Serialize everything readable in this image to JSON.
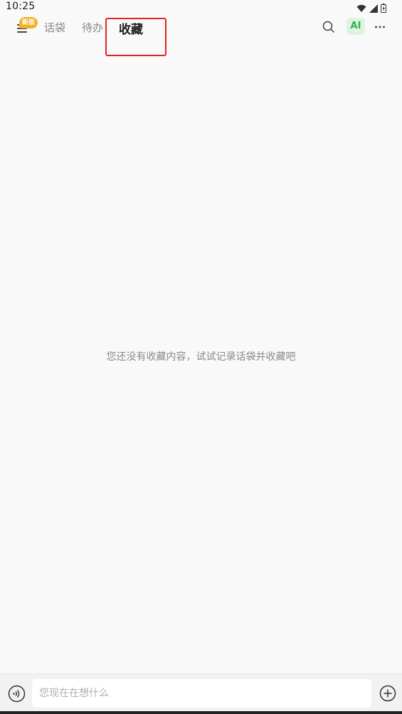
{
  "status_bar": {
    "time": "10:25"
  },
  "nav": {
    "new_badge": "新版",
    "tabs": [
      {
        "label": "话袋",
        "active": false
      },
      {
        "label": "待办",
        "active": false
      },
      {
        "label": "收藏",
        "active": true
      }
    ],
    "ai_label": "AI"
  },
  "main": {
    "empty_message": "您还没有收藏内容，试试记录话袋并收藏吧"
  },
  "input_bar": {
    "placeholder": "您现在在想什么"
  },
  "colors": {
    "background": "#f9f9f9",
    "badge": "#f3b125",
    "ai_green": "#33b14a",
    "highlight_red": "#e02424"
  },
  "icons": [
    "wifi-icon",
    "signal-icon",
    "battery-icon",
    "menu-icon",
    "search-icon",
    "more-icon",
    "voice-icon",
    "plus-icon"
  ]
}
